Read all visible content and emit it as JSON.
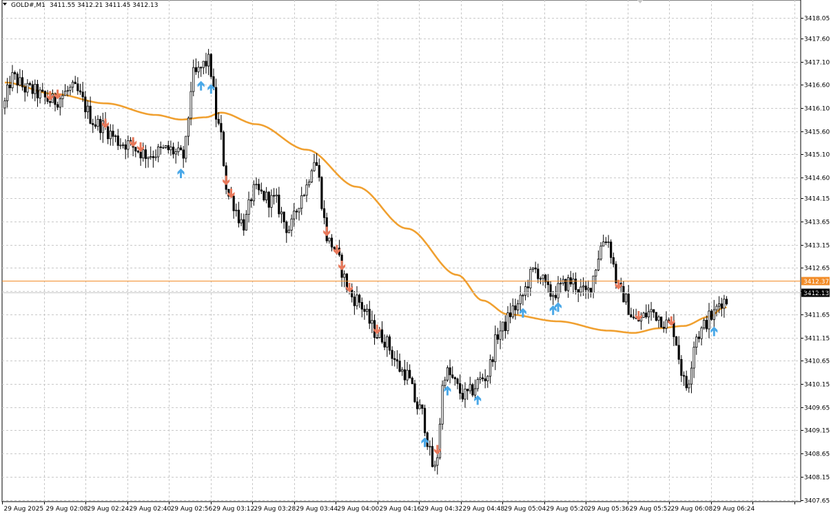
{
  "header": {
    "symbol": "GOLD#,M1",
    "ohlc": "3411.55 3412.21 3411.45 3412.13"
  },
  "chart_data": {
    "type": "candlestick",
    "symbol": "GOLD#,M1",
    "ylim": [
      3407.55,
      3418.35
    ],
    "grid": true,
    "y_ticks": [
      "3418.05",
      "3417.60",
      "3417.10",
      "3416.60",
      "3416.10",
      "3415.60",
      "3415.10",
      "3414.60",
      "3414.15",
      "3413.65",
      "3413.15",
      "3412.65",
      "3412.15",
      "3411.65",
      "3411.15",
      "3410.65",
      "3410.15",
      "3409.65",
      "3409.15",
      "3408.65",
      "3408.15",
      "3407.65"
    ],
    "x_ticks": [
      "29 Aug 2025",
      "29 Aug 02:08",
      "29 Aug 02:24",
      "29 Aug 02:40",
      "29 Aug 02:56",
      "29 Aug 03:12",
      "29 Aug 03:28",
      "29 Aug 03:44",
      "29 Aug 04:00",
      "29 Aug 04:16",
      "29 Aug 04:32",
      "29 Aug 04:48",
      "29 Aug 05:04",
      "29 Aug 05:20",
      "29 Aug 05:36",
      "29 Aug 05:52",
      "29 Aug 06:08",
      "29 Aug 06:24"
    ],
    "price_anchors": [
      [
        0,
        3416.1
      ],
      [
        4,
        3416.75
      ],
      [
        10,
        3416.5
      ],
      [
        20,
        3416.25
      ],
      [
        28,
        3416.5
      ],
      [
        38,
        3415.75
      ],
      [
        48,
        3415.35
      ],
      [
        58,
        3415.1
      ],
      [
        66,
        3415.2
      ],
      [
        72,
        3415.05
      ],
      [
        76,
        3416.8
      ],
      [
        82,
        3417.1
      ],
      [
        86,
        3415.7
      ],
      [
        90,
        3414.2
      ],
      [
        96,
        3413.6
      ],
      [
        100,
        3414.3
      ],
      [
        108,
        3414.1
      ],
      [
        114,
        3413.5
      ],
      [
        120,
        3414.3
      ],
      [
        124,
        3415.0
      ],
      [
        130,
        3413.2
      ],
      [
        140,
        3412.0
      ],
      [
        150,
        3411.2
      ],
      [
        160,
        3410.4
      ],
      [
        166,
        3409.6
      ],
      [
        172,
        3408.3
      ],
      [
        176,
        3410.4
      ],
      [
        184,
        3409.9
      ],
      [
        192,
        3410.3
      ],
      [
        198,
        3411.3
      ],
      [
        204,
        3411.8
      ],
      [
        212,
        3412.6
      ],
      [
        218,
        3412.1
      ],
      [
        226,
        3412.35
      ],
      [
        232,
        3412.1
      ],
      [
        240,
        3413.3
      ],
      [
        246,
        3412.1
      ],
      [
        252,
        3411.5
      ],
      [
        258,
        3411.7
      ],
      [
        266,
        3411.4
      ],
      [
        272,
        3410.1
      ],
      [
        276,
        3411.2
      ],
      [
        282,
        3411.6
      ],
      [
        286,
        3411.95
      ]
    ],
    "ma_series": {
      "name": "Moving Average",
      "color": "#f0a030",
      "points": [
        [
          0,
          3416.65
        ],
        [
          20,
          3416.4
        ],
        [
          40,
          3416.2
        ],
        [
          60,
          3415.95
        ],
        [
          70,
          3415.85
        ],
        [
          80,
          3415.9
        ],
        [
          86,
          3416.0
        ],
        [
          100,
          3415.75
        ],
        [
          120,
          3415.2
        ],
        [
          140,
          3414.4
        ],
        [
          160,
          3413.5
        ],
        [
          180,
          3412.5
        ],
        [
          190,
          3411.95
        ],
        [
          200,
          3411.65
        ],
        [
          220,
          3411.5
        ],
        [
          240,
          3411.3
        ],
        [
          250,
          3411.25
        ],
        [
          260,
          3411.35
        ],
        [
          270,
          3411.4
        ],
        [
          280,
          3411.6
        ],
        [
          286,
          3411.8
        ]
      ]
    },
    "sell_arrows": [
      18,
      21,
      40,
      51,
      54,
      88,
      90,
      128,
      132,
      134,
      137,
      148,
      172,
      244,
      252,
      265
    ],
    "buy_arrows": [
      78,
      82,
      70,
      167,
      176,
      188,
      206,
      218,
      220,
      282
    ],
    "price_levels": [
      {
        "value": "3412.37",
        "color": "#f28c28"
      },
      {
        "value": "3412.13",
        "color": "#000000"
      }
    ]
  }
}
